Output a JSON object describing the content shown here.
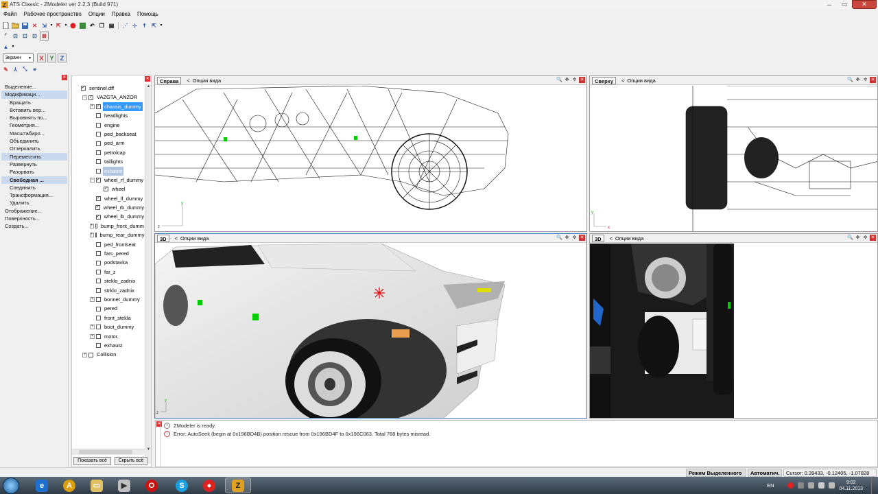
{
  "window": {
    "title": "ATS Classic - ZModeler ver 2.2.3 (Build 971)"
  },
  "menu": [
    "Файл",
    "Рабочее пространство",
    "Опции",
    "Правка",
    "Помощь"
  ],
  "toolbar2": {
    "screen_select": "Экранн",
    "axes": [
      "X",
      "Y",
      "Z"
    ]
  },
  "commands": [
    {
      "label": "Выделение...",
      "sub": false
    },
    {
      "label": "Модификаци...",
      "sub": false,
      "state": "active"
    },
    {
      "label": "Вращать",
      "sub": true
    },
    {
      "label": "Вставить вер...",
      "sub": true
    },
    {
      "label": "Выровнять по...",
      "sub": true
    },
    {
      "label": "Геометрия...",
      "sub": true
    },
    {
      "label": "Масштабиро...",
      "sub": true
    },
    {
      "label": "Объединить",
      "sub": true
    },
    {
      "label": "Отзеркалить",
      "sub": true
    },
    {
      "label": "Переместить",
      "sub": true,
      "state": "active"
    },
    {
      "label": "Развернуть",
      "sub": true
    },
    {
      "label": "Разорвать",
      "sub": true
    },
    {
      "label": "Свободная ...",
      "sub": true,
      "state": "bold"
    },
    {
      "label": "Соединить",
      "sub": true
    },
    {
      "label": "Трансформация...",
      "sub": true
    },
    {
      "label": "Удалить",
      "sub": true
    },
    {
      "label": "Отображение...",
      "sub": false
    },
    {
      "label": "Поверхность...",
      "sub": false
    },
    {
      "label": "Создать...",
      "sub": false
    }
  ],
  "tree": [
    {
      "label": "sentinel.dff",
      "level": 0,
      "exp": "",
      "checked": true
    },
    {
      "label": "VAZGTA_ANZOR",
      "level": 1,
      "exp": "−",
      "checked": true
    },
    {
      "label": "chassis_dummy",
      "level": 2,
      "exp": "+",
      "checked": true,
      "sel": "primary"
    },
    {
      "label": "headlights",
      "level": 2,
      "exp": "",
      "checked": false
    },
    {
      "label": "engine",
      "level": 2,
      "exp": "",
      "checked": false
    },
    {
      "label": "ped_backseat",
      "level": 2,
      "exp": "",
      "checked": false
    },
    {
      "label": "ped_arm",
      "level": 2,
      "exp": "",
      "checked": false
    },
    {
      "label": "petrolcap",
      "level": 2,
      "exp": "",
      "checked": false
    },
    {
      "label": "taillights",
      "level": 2,
      "exp": "",
      "checked": false
    },
    {
      "label": "exhaust",
      "level": 2,
      "exp": "",
      "checked": false,
      "sel": "secondary"
    },
    {
      "label": "wheel_rf_dummy",
      "level": 2,
      "exp": "−",
      "checked": true
    },
    {
      "label": "wheel",
      "level": 3,
      "exp": "",
      "checked": true
    },
    {
      "label": "wheel_lf_dummy",
      "level": 2,
      "exp": "",
      "checked": true
    },
    {
      "label": "wheel_rb_dummy",
      "level": 2,
      "exp": "",
      "checked": true
    },
    {
      "label": "wheel_lb_dummy",
      "level": 2,
      "exp": "",
      "checked": true
    },
    {
      "label": "bump_front_dumm",
      "level": 2,
      "exp": "+",
      "checked": false
    },
    {
      "label": "bump_rear_dummy",
      "level": 2,
      "exp": "+",
      "checked": false
    },
    {
      "label": "ped_frontseat",
      "level": 2,
      "exp": "",
      "checked": false
    },
    {
      "label": "fars_pered",
      "level": 2,
      "exp": "",
      "checked": false
    },
    {
      "label": "podstavka",
      "level": 2,
      "exp": "",
      "checked": false
    },
    {
      "label": "far_z",
      "level": 2,
      "exp": "",
      "checked": false
    },
    {
      "label": "steklo_zadnix",
      "level": 2,
      "exp": "",
      "checked": false
    },
    {
      "label": "strklo_zadnix",
      "level": 2,
      "exp": "",
      "checked": false
    },
    {
      "label": "bonnet_dummy",
      "level": 2,
      "exp": "+",
      "checked": false
    },
    {
      "label": "pered",
      "level": 2,
      "exp": "",
      "checked": false
    },
    {
      "label": "front_stekla",
      "level": 2,
      "exp": "",
      "checked": false
    },
    {
      "label": "boot_dummy",
      "level": 2,
      "exp": "+",
      "checked": false
    },
    {
      "label": "motor.",
      "level": 2,
      "exp": "+",
      "checked": false
    },
    {
      "label": "exhaust",
      "level": 2,
      "exp": "",
      "checked": false
    },
    {
      "label": "Collision",
      "level": 1,
      "exp": "+",
      "checked": false
    }
  ],
  "tree_buttons": {
    "show_all": "Показать всё",
    "hide_all": "Скрыть всё"
  },
  "viewports": {
    "right": {
      "tag": "Справа",
      "options": "Опции вида"
    },
    "top": {
      "tag": "Сверху",
      "options": "Опции вида"
    },
    "persp1": {
      "tag": "3D",
      "options": "Опции вида"
    },
    "persp2": {
      "tag": "3D",
      "options": "Опции вида"
    }
  },
  "log": [
    "ZModeler is ready.",
    "Error: AutoSeek (begin at 0x196BD4B) position rescue  from 0x196BD4F to 0x196C063. Total 788 bytes misread."
  ],
  "status": {
    "mode": "Режим Выделенного",
    "auto": "Автоматич.",
    "cursor": "Cursor: 0.39433, -0.12405, -1.07828"
  },
  "tray": {
    "lang": "EN",
    "time": "9:02",
    "date": "04.11.2013"
  },
  "colors": {
    "selection": "#3399ff",
    "close": "#c9473d",
    "taskbar": "#3b4854"
  }
}
